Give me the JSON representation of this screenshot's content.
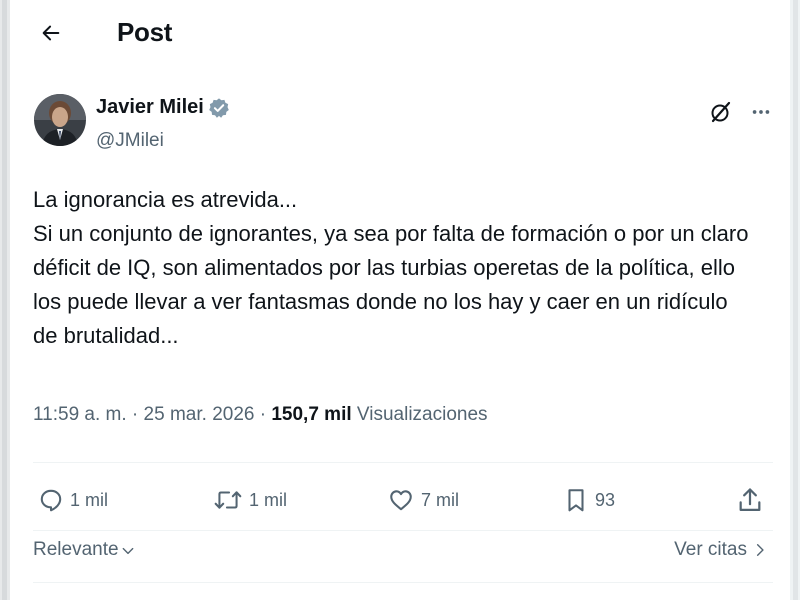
{
  "header": {
    "title": "Post",
    "back_icon": "arrow-left-icon"
  },
  "author": {
    "name": "Javier Milei",
    "handle": "@JMilei",
    "verified": true,
    "verified_color": "#829aab"
  },
  "post": {
    "lines": [
      "La ignorancia es atrevida...",
      "Si un conjunto de ignorantes, ya sea por falta de formación o por un claro",
      "déficit de IQ, son alimentados por las turbias operetas de la política, ello",
      "los puede llevar a ver fantasmas donde no los hay y caer en un ridículo",
      "de brutalidad..."
    ]
  },
  "meta": {
    "time": "11:59 a. m.",
    "separator": " · ",
    "date": "25 mar. 2026",
    "views_count": "150,7 mil",
    "views_label": "Visualizaciones"
  },
  "actions": {
    "replies": "1 mil",
    "reposts": "1 mil",
    "likes": "7 mil",
    "bookmarks": "93"
  },
  "footer": {
    "sort_label": "Relevante",
    "quotes_label": "Ver citas"
  },
  "colors": {
    "text": "#0f1419",
    "secondary": "#536471",
    "divider": "#eff3f4"
  }
}
